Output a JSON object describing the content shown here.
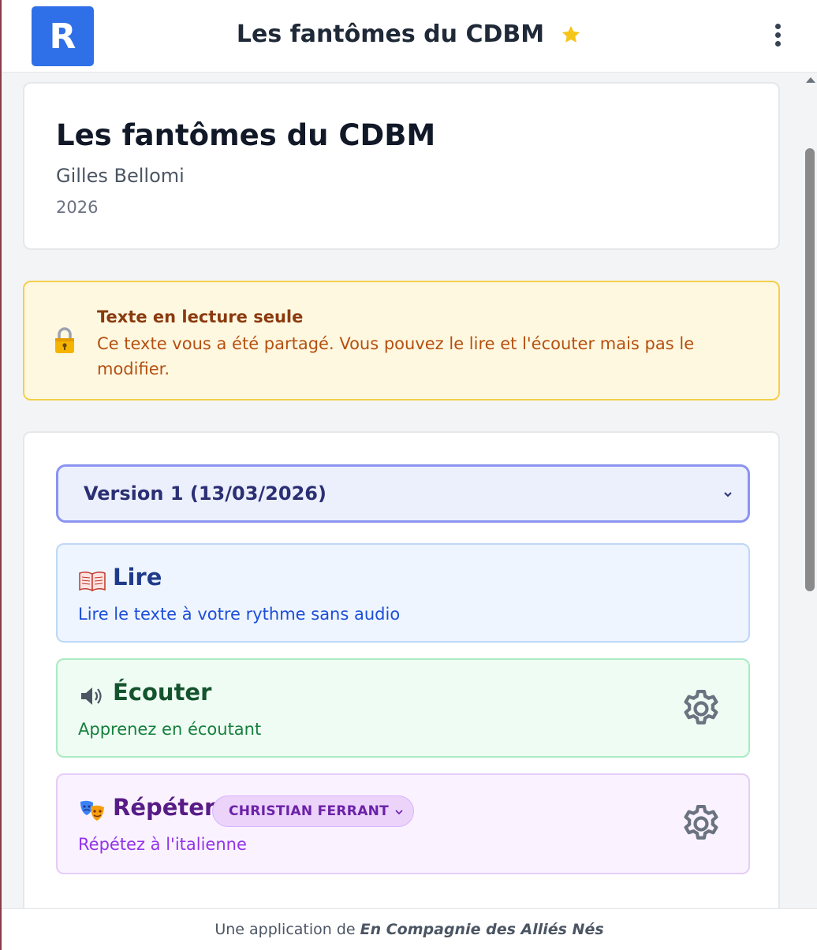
{
  "header": {
    "logo_letter": "R",
    "title": "Les fantômes du CDBM",
    "favorite_icon": "star-icon",
    "favorite_color": "#f5c518",
    "menu_icon": "more-vertical-icon"
  },
  "book": {
    "title": "Les fantômes du CDBM",
    "author": "Gilles Bellomi",
    "year": "2026"
  },
  "notice": {
    "icon": "lock-icon",
    "title": "Texte en lecture seule",
    "text": "Ce texte vous a été partagé. Vous pouvez le lire et l'écouter mais pas le modifier."
  },
  "version_select": {
    "selected": "Version 1 (13/03/2026)"
  },
  "modes": [
    {
      "id": "read",
      "icon": "book-icon",
      "title": "Lire",
      "description": "Lire le texte à votre rythme sans audio"
    },
    {
      "id": "listen",
      "icon": "speaker-icon",
      "title": "Écouter",
      "description": "Apprenez en écoutant",
      "settings_icon": "gear-icon"
    },
    {
      "id": "repeat",
      "icon": "theater-masks-icon",
      "title": "Répéter",
      "role": "CHRISTIAN FERRANT",
      "description": "Répétez à l'italienne",
      "settings_icon": "gear-icon"
    }
  ],
  "footer": {
    "prefix": "Une application de",
    "brand": "En Compagnie des Alliés Nés"
  },
  "colors": {
    "logo": "#2f6fe8",
    "read_accent": "#1d4ed8",
    "listen_accent": "#15803d",
    "repeat_accent": "#9333ea",
    "notice_border": "#f5cf4b"
  }
}
